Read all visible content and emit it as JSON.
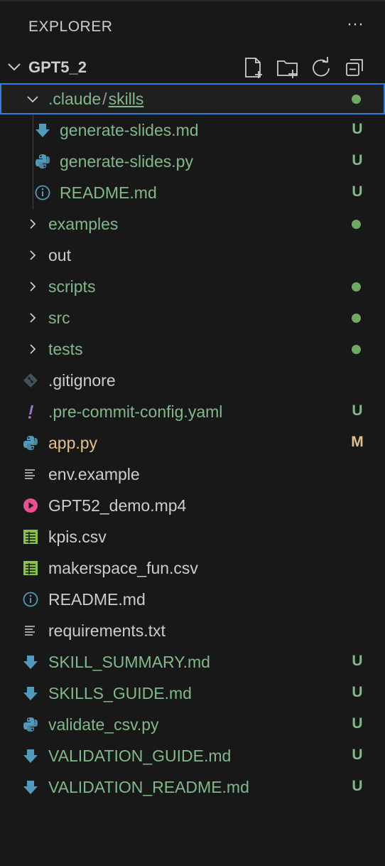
{
  "panel": {
    "title": "EXPLORER",
    "more_icon": "ellipsis-icon"
  },
  "workspace": {
    "name": "GPT5_2",
    "actions": [
      "new-file-icon",
      "new-folder-icon",
      "refresh-icon",
      "collapse-all-icon"
    ]
  },
  "tree": [
    {
      "depth": 1,
      "kind": "folder-open",
      "label": ".claude",
      "label2": "skills",
      "sep": "/",
      "status": "dot",
      "color": "green",
      "selected": true
    },
    {
      "depth": 2,
      "kind": "file",
      "icon": "markdown-download-icon",
      "label": "generate-slides.md",
      "status": "U",
      "color": "green"
    },
    {
      "depth": 2,
      "kind": "file",
      "icon": "python-icon",
      "label": "generate-slides.py",
      "status": "U",
      "color": "green"
    },
    {
      "depth": 2,
      "kind": "file",
      "icon": "info-icon",
      "label": "README.md",
      "status": "U",
      "color": "green"
    },
    {
      "depth": 1,
      "kind": "folder",
      "label": "examples",
      "status": "dot",
      "color": "green"
    },
    {
      "depth": 1,
      "kind": "folder",
      "label": "out",
      "status": "",
      "color": "plain"
    },
    {
      "depth": 1,
      "kind": "folder",
      "label": "scripts",
      "status": "dot",
      "color": "green"
    },
    {
      "depth": 1,
      "kind": "folder",
      "label": "src",
      "status": "dot",
      "color": "green"
    },
    {
      "depth": 1,
      "kind": "folder",
      "label": "tests",
      "status": "dot",
      "color": "green"
    },
    {
      "depth": 1,
      "kind": "file",
      "icon": "git-icon",
      "label": ".gitignore",
      "status": "",
      "color": "plain"
    },
    {
      "depth": 1,
      "kind": "file",
      "icon": "yaml-icon",
      "label": ".pre-commit-config.yaml",
      "status": "U",
      "color": "green"
    },
    {
      "depth": 1,
      "kind": "file",
      "icon": "python-icon",
      "label": "app.py",
      "status": "M",
      "color": "mod"
    },
    {
      "depth": 1,
      "kind": "file",
      "icon": "text-lines-icon",
      "label": "env.example",
      "status": "",
      "color": "plain"
    },
    {
      "depth": 1,
      "kind": "file",
      "icon": "video-play-icon",
      "label": "GPT52_demo.mp4",
      "status": "",
      "color": "plain"
    },
    {
      "depth": 1,
      "kind": "file",
      "icon": "csv-table-icon",
      "label": "kpis.csv",
      "status": "",
      "color": "plain"
    },
    {
      "depth": 1,
      "kind": "file",
      "icon": "csv-table-icon",
      "label": "makerspace_fun.csv",
      "status": "",
      "color": "plain"
    },
    {
      "depth": 1,
      "kind": "file",
      "icon": "info-icon",
      "label": "README.md",
      "status": "",
      "color": "plain"
    },
    {
      "depth": 1,
      "kind": "file",
      "icon": "text-lines-icon",
      "label": "requirements.txt",
      "status": "",
      "color": "plain"
    },
    {
      "depth": 1,
      "kind": "file",
      "icon": "markdown-download-icon",
      "label": "SKILL_SUMMARY.md",
      "status": "U",
      "color": "green"
    },
    {
      "depth": 1,
      "kind": "file",
      "icon": "markdown-download-icon",
      "label": "SKILLS_GUIDE.md",
      "status": "U",
      "color": "green"
    },
    {
      "depth": 1,
      "kind": "file",
      "icon": "python-icon",
      "label": "validate_csv.py",
      "status": "U",
      "color": "green"
    },
    {
      "depth": 1,
      "kind": "file",
      "icon": "markdown-download-icon",
      "label": "VALIDATION_GUIDE.md",
      "status": "U",
      "color": "green"
    },
    {
      "depth": 1,
      "kind": "file",
      "icon": "markdown-download-icon",
      "label": "VALIDATION_README.md",
      "status": "U",
      "color": "green"
    }
  ],
  "colors": {
    "untracked": "#81b88b",
    "modified": "#e2c08d",
    "selection": "#2f7fd6",
    "icon_blue": "#519aba",
    "icon_csv": "#8bc34a",
    "icon_video": "#e8508f",
    "icon_yaml": "#a074c4"
  }
}
